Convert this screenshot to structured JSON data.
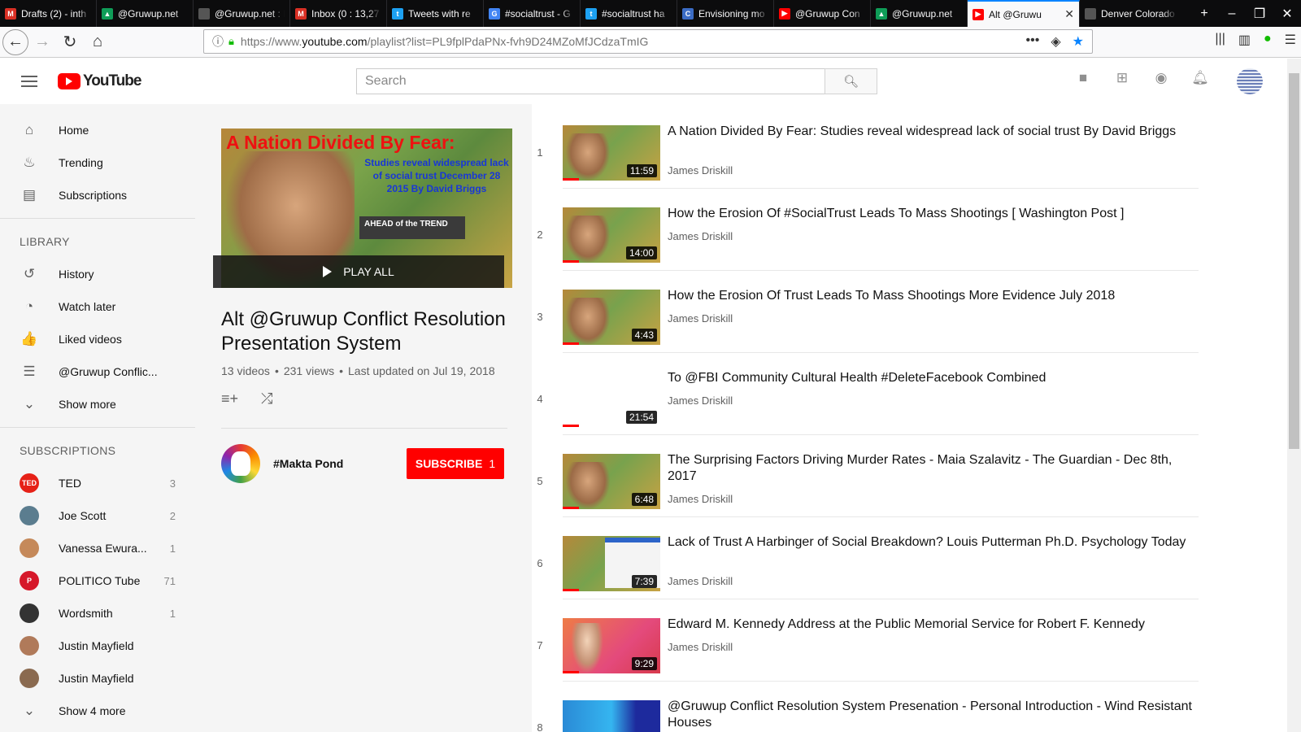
{
  "browser": {
    "tabs": [
      {
        "title": "Drafts (2) - inth",
        "fav": "M",
        "color": "#d93025"
      },
      {
        "title": "@Gruwup.net",
        "fav": "▲",
        "color": "#0f9d58"
      },
      {
        "title": "@Gruwup.net : Pea",
        "fav": "",
        "color": "#555"
      },
      {
        "title": "Inbox (0 : 13,27",
        "fav": "M",
        "color": "#d93025"
      },
      {
        "title": "Tweets with re",
        "fav": "t",
        "color": "#1da1f2"
      },
      {
        "title": "#socialtrust - G",
        "fav": "G",
        "color": "#4285f4"
      },
      {
        "title": "#socialtrust ha",
        "fav": "t",
        "color": "#1da1f2"
      },
      {
        "title": "Envisioning mo",
        "fav": "C",
        "color": "#3b6cc5"
      },
      {
        "title": "@Gruwup Con",
        "fav": "▶",
        "color": "#f00"
      },
      {
        "title": "@Gruwup.net",
        "fav": "▲",
        "color": "#0f9d58"
      },
      {
        "title": "Alt @Gruwu",
        "fav": "▶",
        "color": "#f00",
        "active": true
      },
      {
        "title": "Denver Colorado A",
        "fav": "",
        "color": "#555"
      }
    ],
    "url_prefix": "https://www.",
    "url_domain": "youtube.com",
    "url_rest": "/playlist?list=PL9fplPdaPNx-fvh9D24MZoMfJCdzaTmIG"
  },
  "youtube": {
    "logo_text": "YouTube",
    "search_placeholder": "Search"
  },
  "sidebar": {
    "main": [
      {
        "label": "Home",
        "icon": "home-icon",
        "glyph": "⌂"
      },
      {
        "label": "Trending",
        "icon": "flame-icon",
        "glyph": "♨"
      },
      {
        "label": "Subscriptions",
        "icon": "subscriptions-icon",
        "glyph": "▤"
      }
    ],
    "library_heading": "LIBRARY",
    "library": [
      {
        "label": "History",
        "icon": "history-icon",
        "glyph": "↺"
      },
      {
        "label": "Watch later",
        "icon": "clock-icon",
        "glyph": "◔"
      },
      {
        "label": "Liked videos",
        "icon": "thumbs-up-icon",
        "glyph": "👍"
      },
      {
        "label": "@Gruwup Conflic...",
        "icon": "playlist-icon",
        "glyph": "☰"
      },
      {
        "label": "Show more",
        "icon": "chevron-down-icon",
        "glyph": "⌄"
      }
    ],
    "subscriptions_heading": "SUBSCRIPTIONS",
    "subscriptions": [
      {
        "label": "TED",
        "count": "3",
        "bg": "#e62117",
        "txt": "TED"
      },
      {
        "label": "Joe Scott",
        "count": "2",
        "bg": "#5b7d8f",
        "txt": ""
      },
      {
        "label": "Vanessa Ewura...",
        "count": "1",
        "bg": "#c5895a",
        "txt": ""
      },
      {
        "label": "POLITICO Tube",
        "count": "71",
        "bg": "#d6182a",
        "txt": "P"
      },
      {
        "label": "Wordsmith",
        "count": "1",
        "bg": "#333",
        "txt": ""
      },
      {
        "label": "Justin Mayfield",
        "count": "",
        "bg": "#b07a5a",
        "txt": ""
      },
      {
        "label": "Justin Mayfield",
        "count": "",
        "bg": "#8a6a50",
        "txt": ""
      }
    ],
    "show_more_subs": "Show 4 more"
  },
  "playlist": {
    "thumb_title": "A Nation Divided By Fear:",
    "thumb_sub": "Studies reveal widespread lack of social trust December 28 2015 By David Briggs",
    "thumb_brand": "AHEAD of the TREND",
    "play_all": "PLAY ALL",
    "title": "Alt @Gruwup Conflict Resolution Presentation System",
    "videos_count": "13 videos",
    "views": "231 views",
    "updated": "Last updated on Jul 19, 2018",
    "owner": "#Makta Pond",
    "subscribe_label": "SUBSCRIBE",
    "subscribe_count": "1"
  },
  "videos": [
    {
      "idx": "1",
      "title": "A Nation Divided By Fear: Studies reveal widespread lack of social trust By David Briggs",
      "author": "James Driskill",
      "duration": "11:59",
      "style": "a"
    },
    {
      "idx": "2",
      "title": "How the Erosion Of #SocialTrust Leads To Mass Shootings [ Washington Post ]",
      "author": "James Driskill",
      "duration": "14:00",
      "style": "a"
    },
    {
      "idx": "3",
      "title": "How the Erosion Of Trust Leads To Mass Shootings More Evidence July 2018",
      "author": "James Driskill",
      "duration": "4:43",
      "style": "a"
    },
    {
      "idx": "4",
      "title": "To @FBI Community Cultural Health #DeleteFacebook Combined",
      "author": "James Driskill",
      "duration": "21:54",
      "style": "b"
    },
    {
      "idx": "5",
      "title": "The Surprising Factors Driving Murder Rates - Maia Szalavitz - The Guardian - Dec 8th, 2017",
      "author": "James Driskill",
      "duration": "6:48",
      "style": "a"
    },
    {
      "idx": "6",
      "title": "Lack of Trust A Harbinger of Social Breakdown? Louis Putterman Ph.D. Psychology Today",
      "author": "James Driskill",
      "duration": "7:39",
      "style": "e"
    },
    {
      "idx": "7",
      "title": "Edward M. Kennedy Address at the Public Memorial Service for Robert F. Kennedy",
      "author": "James Driskill",
      "duration": "9:29",
      "style": "c"
    },
    {
      "idx": "8",
      "title": "@Gruwup Conflict Resolution System Presenation - Personal Introduction - Wind Resistant Houses",
      "author": "",
      "duration": "",
      "style": "d"
    }
  ]
}
